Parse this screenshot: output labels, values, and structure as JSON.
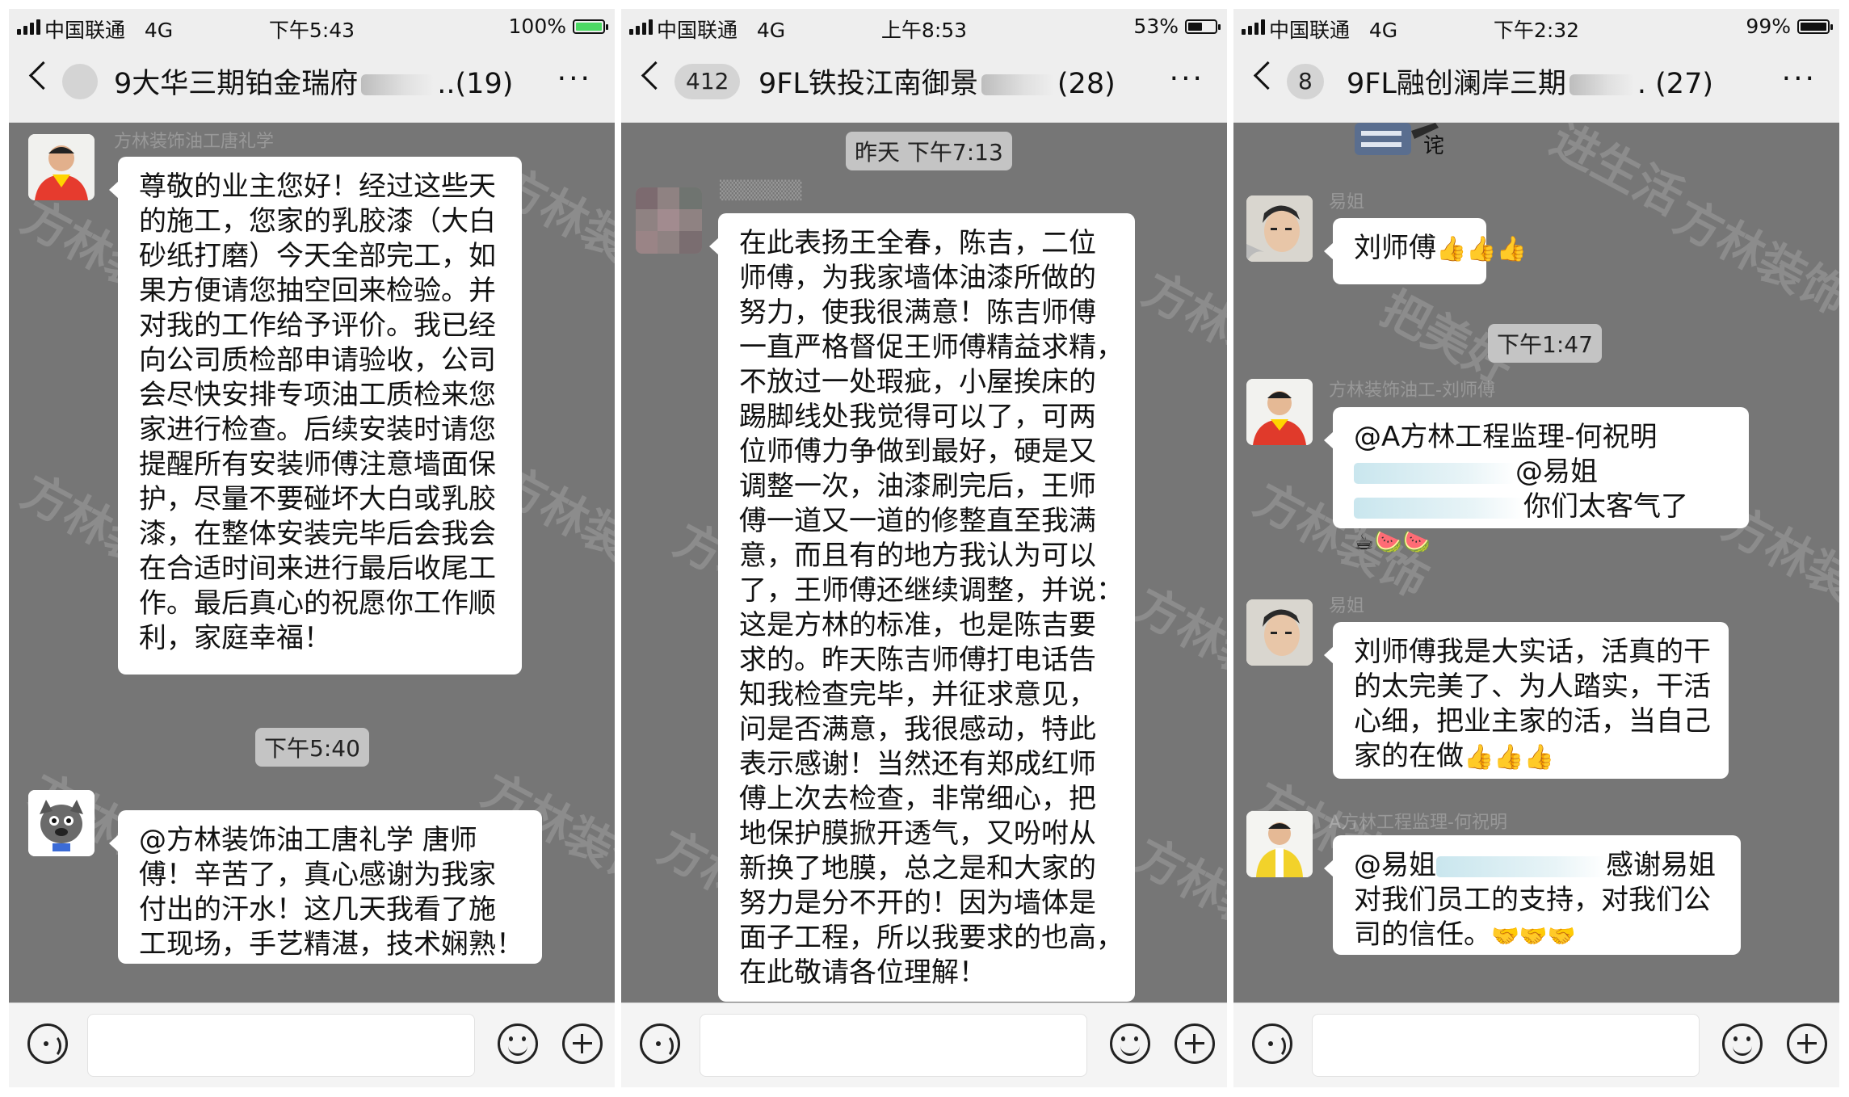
{
  "panels": [
    {
      "status": {
        "carrier": "中国联通",
        "network": "4G",
        "time": "下午5:43",
        "battery": "100%",
        "battery_level": 1.0,
        "battery_color": "#4cd964"
      },
      "nav": {
        "badge": "",
        "title_left": "9大华三期铂金瑞府",
        "title_right": "..(19)",
        "more": "···"
      },
      "timestamps": [
        "下午5:40"
      ],
      "messages": [
        {
          "lines": [
            "尊敬的业主您好！经过这些天",
            "的施工，您家的乳胶漆（大白",
            "砂纸打磨）今天全部完工，如",
            "果方便请您抽空回来检验。并",
            "对我的工作给予评价。我已经",
            "向公司质检部申请验收，公司",
            "会尽快安排专项油工质检来您",
            "家进行检查。后续安装时请您",
            "提醒所有安装师傅注意墙面保",
            "护，尽量不要碰坏大白或乳胶",
            "漆，在整体安装完毕后会我会",
            "在合适时间来进行最后收尾工",
            "作。最后真心的祝愿你工作顺",
            "利，家庭幸福！"
          ]
        },
        {
          "lines": [
            "@方林装饰油工唐礼学 唐师",
            "傅！辛苦了，真心感谢为我家",
            "付出的汗水！这几天我看了施",
            "工现场，手艺精湛，技术娴熟！"
          ]
        }
      ],
      "watermarks": [
        "方林装饰",
        "方林装饰",
        "方林装饰",
        "方林装饰",
        "方林装饰",
        "方林装饰"
      ]
    },
    {
      "status": {
        "carrier": "中国联通",
        "network": "4G",
        "time": "上午8:53",
        "battery": "53%",
        "battery_level": 0.53,
        "battery_color": "#111111"
      },
      "nav": {
        "badge": "412",
        "title_left": "9FL铁投江南御景",
        "title_right": "(28)",
        "more": "···"
      },
      "timestamps": [
        "昨天 下午7:13"
      ],
      "messages": [
        {
          "lines": [
            "在此表扬王全春，陈吉，二位",
            "师傅，为我家墙体油漆所做的",
            "努力，使我很满意！陈吉师傅",
            "一直严格督促王师傅精益求精，",
            "不放过一处瑕疵，小屋挨床的",
            "踢脚线处我觉得可以了，可两",
            "位师傅力争做到最好，硬是又",
            "调整一次，油漆刷完后，王师",
            "傅一道又一道的修整直至我满",
            "意，而且有的地方我认为可以",
            "了，王师傅还继续调整，并说：",
            "这是方林的标准，也是陈吉要",
            "求的。昨天陈吉师傅打电话告",
            "知我检查完毕，并征求意见，",
            "问是否满意，我很感动，特此",
            "表示感谢！当然还有郑成红师",
            "傅上次去检查，非常细心，把",
            "地保护膜掀开透气，又吩咐从",
            "新换了地膜，总之是和大家的",
            "努力是分不开的！因为墙体是",
            "面子工程，所以我要求的也高，",
            "在此敬请各位理解！"
          ]
        }
      ],
      "watermarks": [
        "方林装饰",
        "方林装饰",
        "方林装饰",
        "方林装饰",
        "方林装饰"
      ]
    },
    {
      "status": {
        "carrier": "中国联通",
        "network": "4G",
        "time": "下午2:32",
        "battery": "99%",
        "battery_level": 0.99,
        "battery_color": "#111111"
      },
      "nav": {
        "badge": "8",
        "title_left": "9FL融创澜岸三期",
        "title_right": ". (27)",
        "more": "···"
      },
      "timestamps": [
        "下午1:47"
      ],
      "messages": [
        {
          "lines": [
            "刘师傅"
          ],
          "emoji": "👍👍👍"
        },
        {
          "lines": [
            "@A方林工程监理-何祝明",
            "@易姐",
            "你们太客气了"
          ],
          "emoji_line": "☕🍉🍉"
        },
        {
          "lines": [
            "刘师傅我是大实话，活真的干",
            "的太完美了、为人踏实，干活",
            "心细，把业主家的活，当自己",
            "家的在做"
          ],
          "emoji": "👍👍👍"
        },
        {
          "lines": [
            "@易姐",
            "感谢易姐",
            "对我们员工的支持，对我们公",
            "司的信任。"
          ],
          "emoji": "🤝🤝🤝"
        }
      ],
      "watermarks": [
        "进生活",
        "方林装饰",
        "把美好",
        "方林装饰",
        "方林装饰",
        "方林装饰"
      ]
    }
  ],
  "icons": {
    "signal": "signal-icon",
    "battery": "battery-icon",
    "back": "back-chevron-icon",
    "more": "more-dots-icon",
    "voice": "voice-icon",
    "emoji": "emoji-icon",
    "plus": "plus-icon"
  }
}
